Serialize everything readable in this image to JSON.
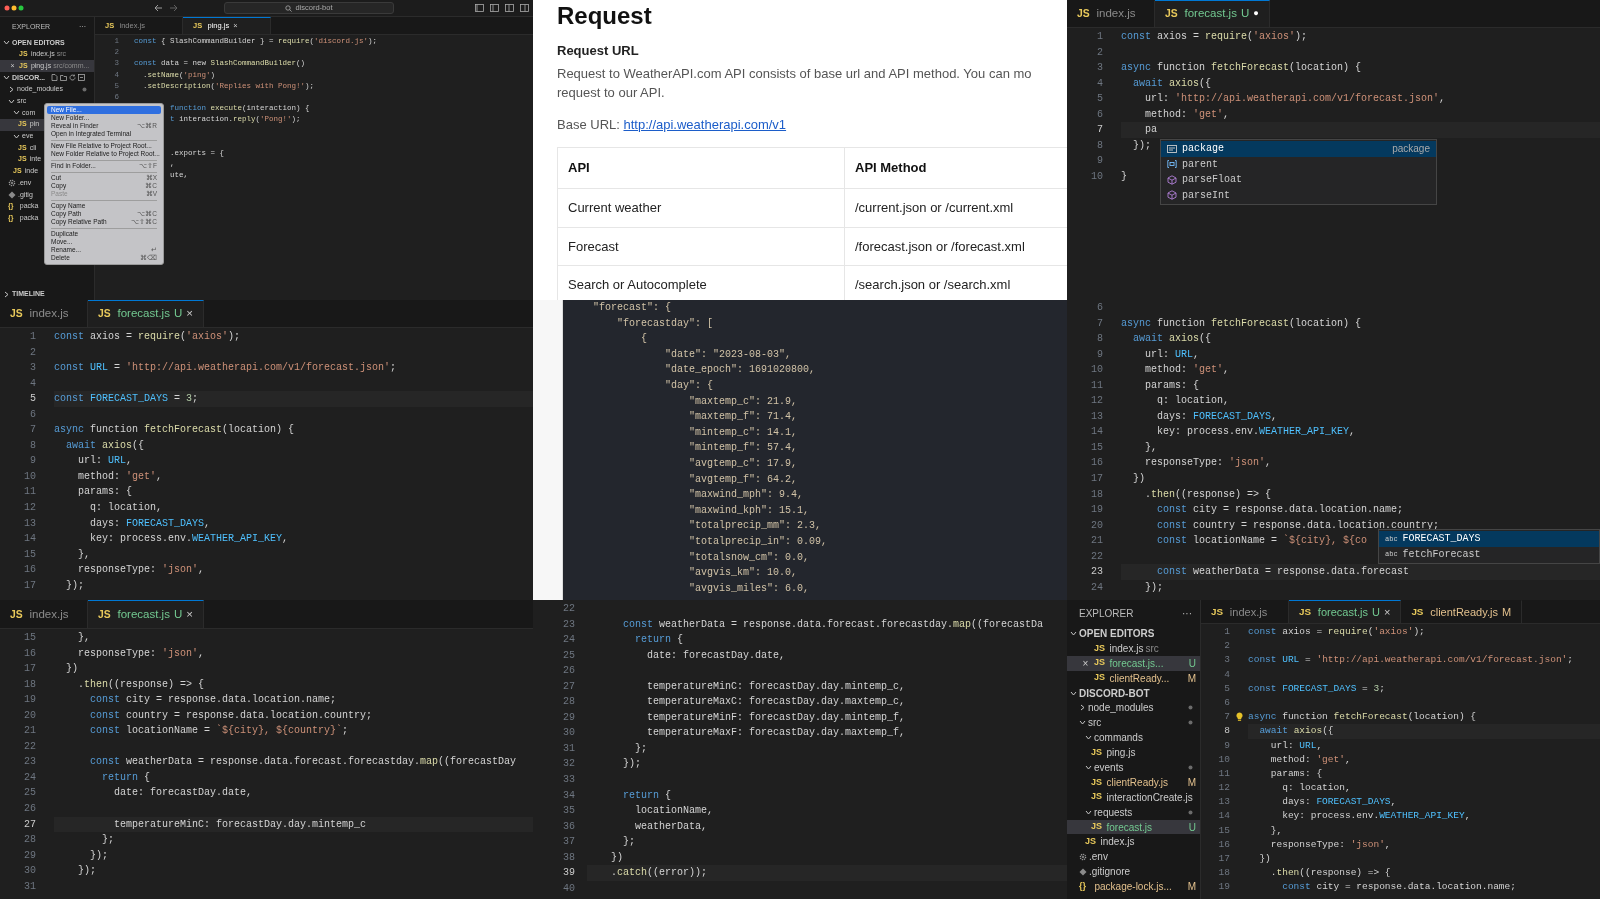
{
  "panels": [
    {
      "kind": "editor",
      "title_bar": {
        "search": "discord-bot"
      },
      "explorer": {
        "title": "EXPLORER",
        "more": "···",
        "sections": [
          {
            "kind": "open_editors",
            "label": "OPEN EDITORS",
            "expanded": true,
            "items": [
              {
                "icon": "JS",
                "label": "index.js",
                "hint": "src",
                "selected": false
              },
              {
                "close": "×",
                "icon": "JS",
                "label": "ping.js",
                "hint": "src/comm...",
                "selected": true
              }
            ]
          },
          {
            "kind": "folder",
            "label": "DISCOR...",
            "expanded": true,
            "toolbar": true,
            "items": [
              {
                "label": "node_modules",
                "expanded": false,
                "changes": true,
                "selected": false
              },
              {
                "label": "src",
                "expanded": true,
                "selected": false,
                "children": [
                  {
                    "label": "com",
                    "expanded": true,
                    "selected": false,
                    "children": [
                      {
                        "icon": "JS",
                        "label": "pin",
                        "selected": true
                      }
                    ]
                  },
                  {
                    "label": "eve",
                    "expanded": true,
                    "selected": false,
                    "children": [
                      {
                        "icon": "JS",
                        "label": "cli",
                        "selected": false
                      },
                      {
                        "icon": "JS",
                        "label": "inte",
                        "selected": false
                      }
                    ]
                  },
                  {
                    "icon": "JS",
                    "label": "inde",
                    "selected": false
                  }
                ]
              },
              {
                "kind": "env",
                "label": ".env",
                "selected": false
              },
              {
                "kind": "git",
                "label": ".gitig",
                "selected": false
              },
              {
                "icon": "{}",
                "label": "packa",
                "selected": false
              },
              {
                "icon": "{}",
                "label": "packa",
                "selected": false
              }
            ]
          },
          {
            "kind": "panel",
            "label": "TIMELINE",
            "expanded": false
          }
        ]
      },
      "tabs": [
        {
          "icon": "JS",
          "label": "index.js",
          "selected": false
        },
        {
          "icon": "JS",
          "label": "ping.js",
          "close": "×",
          "selected": true
        }
      ],
      "lines": [
        {
          "n": "1",
          "code": "const { SlashCommandBuilder } = require('discord.js');"
        },
        {
          "n": "2"
        },
        {
          "n": "3",
          "code": "const data = new SlashCommandBuilder()"
        },
        {
          "n": "4",
          "code": "  .setName('ping')"
        },
        {
          "n": "5",
          "code": "  .setDescription('Replies with Pong!');"
        },
        {
          "n": "6"
        },
        {
          "code": "function execute(interaction) {"
        },
        {
          "code": "t interaction.reply('Pong!');"
        },
        {
          "code": ".exports = {"
        },
        {
          "code": ","
        },
        {
          "code": "ute,"
        }
      ],
      "context_menu": {
        "groups": [
          [
            {
              "label": "New File...",
              "selected": true,
              "disabled": false
            },
            {
              "label": "New Folder...",
              "selected": false,
              "disabled": false
            },
            {
              "label": "Reveal in Finder",
              "shortcut": "⌥⌘R",
              "selected": false,
              "disabled": false
            },
            {
              "label": "Open in Integrated Terminal",
              "selected": false,
              "disabled": false
            }
          ],
          [
            {
              "label": "New File Relative to Project Root...",
              "selected": false,
              "disabled": false
            },
            {
              "label": "New Folder Relative to Project Root...",
              "selected": false,
              "disabled": false
            }
          ],
          [
            {
              "label": "Find in Folder...",
              "shortcut": "⌥⇧F",
              "selected": false,
              "disabled": false
            }
          ],
          [
            {
              "label": "Cut",
              "shortcut": "⌘X",
              "selected": false,
              "disabled": false
            },
            {
              "label": "Copy",
              "shortcut": "⌘C",
              "selected": false,
              "disabled": false
            },
            {
              "label": "Paste",
              "shortcut": "⌘V",
              "selected": false,
              "disabled": true
            }
          ],
          [
            {
              "label": "Copy Name",
              "selected": false,
              "disabled": false
            },
            {
              "label": "Copy Path",
              "shortcut": "⌥⌘C",
              "selected": false,
              "disabled": false
            },
            {
              "label": "Copy Relative Path",
              "shortcut": "⌥⇧⌘C",
              "selected": false,
              "disabled": false
            }
          ],
          [
            {
              "label": "Duplicate",
              "selected": false,
              "disabled": false
            },
            {
              "label": "Move...",
              "selected": false,
              "disabled": false
            },
            {
              "label": "Rename...",
              "shortcut": "↵",
              "selected": false,
              "disabled": false
            },
            {
              "label": "Delete",
              "shortcut": "⌘⌫",
              "selected": false,
              "disabled": false
            }
          ]
        ]
      }
    },
    {
      "kind": "doc",
      "heading": "Request",
      "subheading": "Request URL",
      "paragraph_lines": [
        "Request to WeatherAPI.com API consists of base url and API method. You can mo",
        "request to our API."
      ],
      "base_url": {
        "label": "Base URL:",
        "link": "http://api.weatherapi.com/v1"
      },
      "table": {
        "columns": [
          "API",
          "API Method"
        ],
        "rows": [
          [
            "Current weather",
            "/current.json or /current.xml"
          ],
          [
            "Forecast",
            "/forecast.json or /forecast.xml"
          ],
          [
            "Search or Autocomplete",
            "/search.json or /search.xml"
          ]
        ]
      }
    },
    {
      "kind": "editor",
      "tabs": [
        {
          "icon": "JS",
          "label": "index.js",
          "selected": false
        },
        {
          "icon": "JS",
          "label": "forecast.js",
          "badge": "U",
          "color": "#73c991",
          "unsaved": "●",
          "selected": true
        }
      ],
      "lines": [
        {
          "n": "1",
          "code": "const axios = require('axios');",
          "current": false
        },
        {
          "n": "2",
          "current": false
        },
        {
          "n": "3",
          "code": "async function fetchForecast(location) {",
          "current": false
        },
        {
          "n": "4",
          "code": "  await axios({",
          "current": false
        },
        {
          "n": "5",
          "code": "    url: 'http://api.weatherapi.com/v1/forecast.json',",
          "current": false
        },
        {
          "n": "6",
          "code": "    method: 'get',",
          "current": false
        },
        {
          "n": "7",
          "code": "    pa",
          "current": true
        },
        {
          "n": "8",
          "code": "  });",
          "current": false
        },
        {
          "n": "9",
          "current": false
        },
        {
          "n": "10",
          "code": "}",
          "current": false
        }
      ],
      "completion": {
        "items": [
          {
            "kind": "module",
            "label": "package",
            "detail": "package",
            "selected": true
          },
          {
            "kind": "variable",
            "label": "parent",
            "selected": false
          },
          {
            "kind": "method",
            "label": "parseFloat",
            "selected": false
          },
          {
            "kind": "method",
            "label": "parseInt",
            "selected": false
          }
        ]
      }
    },
    {
      "kind": "editor",
      "tabs": [
        {
          "icon": "JS",
          "label": "index.js",
          "selected": false
        },
        {
          "icon": "JS",
          "label": "forecast.js",
          "badge": "U",
          "color": "#73c991",
          "close": "×",
          "selected": true
        }
      ],
      "lines": [
        {
          "n": "1",
          "code": "const axios = require('axios');",
          "current": false
        },
        {
          "n": "2",
          "current": false
        },
        {
          "n": "3",
          "code": "const URL = 'http://api.weatherapi.com/v1/forecast.json';",
          "current": false
        },
        {
          "n": "4",
          "current": false
        },
        {
          "n": "5",
          "code": "const FORECAST_DAYS = 3;",
          "current": true
        },
        {
          "n": "6",
          "current": false
        },
        {
          "n": "7",
          "code": "async function fetchForecast(location) {",
          "current": false
        },
        {
          "n": "8",
          "code": "  await axios({",
          "current": false
        },
        {
          "n": "9",
          "code": "    url: URL,",
          "current": false
        },
        {
          "n": "10",
          "code": "    method: 'get',",
          "current": false
        },
        {
          "n": "11",
          "code": "    params: {",
          "current": false
        },
        {
          "n": "12",
          "code": "      q: location,",
          "current": false
        },
        {
          "n": "13",
          "code": "      days: FORECAST_DAYS,",
          "current": false
        },
        {
          "n": "14",
          "code": "      key: process.env.WEATHER_API_KEY,",
          "current": false
        },
        {
          "n": "15",
          "code": "    },",
          "current": false
        },
        {
          "n": "16",
          "code": "    responseType: 'json',",
          "current": false
        },
        {
          "n": "17",
          "code": "  });",
          "current": false
        }
      ]
    },
    {
      "kind": "json",
      "lines": [
        "\"forecast\": {",
        "    \"forecastday\": [",
        "        {",
        "            \"date\": \"2023-08-03\",",
        "            \"date_epoch\": 1691020800,",
        "            \"day\": {",
        "                \"maxtemp_c\": 21.9,",
        "                \"maxtemp_f\": 71.4,",
        "                \"mintemp_c\": 14.1,",
        "                \"mintemp_f\": 57.4,",
        "                \"avgtemp_c\": 17.9,",
        "                \"avgtemp_f\": 64.2,",
        "                \"maxwind_mph\": 9.4,",
        "                \"maxwind_kph\": 15.1,",
        "                \"totalprecip_mm\": 2.3,",
        "                \"totalprecip_in\": 0.09,",
        "                \"totalsnow_cm\": 0.0,",
        "                \"avgvis_km\": 10.0,",
        "                \"avgvis_miles\": 6.0,"
      ]
    },
    {
      "kind": "editor",
      "lines": [
        {
          "n": "6",
          "current": false
        },
        {
          "n": "7",
          "code": "async function fetchForecast(location) {",
          "current": false
        },
        {
          "n": "8",
          "code": "  await axios({",
          "current": false
        },
        {
          "n": "9",
          "code": "    url: URL,",
          "current": false
        },
        {
          "n": "10",
          "code": "    method: 'get',",
          "current": false
        },
        {
          "n": "11",
          "code": "    params: {",
          "current": false
        },
        {
          "n": "12",
          "code": "      q: location,",
          "current": false
        },
        {
          "n": "13",
          "code": "      days: FORECAST_DAYS,",
          "current": false
        },
        {
          "n": "14",
          "code": "      key: process.env.WEATHER_API_KEY,",
          "current": false
        },
        {
          "n": "15",
          "code": "    },",
          "current": false
        },
        {
          "n": "16",
          "code": "    responseType: 'json',",
          "current": false
        },
        {
          "n": "17",
          "code": "  })",
          "current": false
        },
        {
          "n": "18",
          "code": "    .then((response) => {",
          "current": false
        },
        {
          "n": "19",
          "code": "      const city = response.data.location.name;",
          "current": false
        },
        {
          "n": "20",
          "code": "      const country = response.data.location.country;",
          "current": false
        },
        {
          "n": "21",
          "code": "      const locationName = `${city}, ${co",
          "current": false
        },
        {
          "n": "22",
          "current": false
        },
        {
          "n": "23",
          "code": "      const weatherData = response.data.forecast",
          "current": true
        },
        {
          "n": "24",
          "code": "    });",
          "current": false
        }
      ],
      "completion": {
        "items": [
          {
            "icon": "abc",
            "label": "FORECAST_DAYS",
            "selected": true
          },
          {
            "icon": "abc",
            "label": "fetchForecast",
            "selected": false
          }
        ]
      }
    },
    {
      "kind": "editor",
      "tabs": [
        {
          "icon": "JS",
          "label": "index.js",
          "selected": false
        },
        {
          "icon": "JS",
          "label": "forecast.js",
          "badge": "U",
          "color": "#73c991",
          "close": "×",
          "selected": true
        }
      ],
      "lines": [
        {
          "n": "15",
          "code": "    },",
          "current": false
        },
        {
          "n": "16",
          "code": "    responseType: 'json',",
          "current": false
        },
        {
          "n": "17",
          "code": "  })",
          "current": false
        },
        {
          "n": "18",
          "code": "    .then((response) => {",
          "current": false
        },
        {
          "n": "19",
          "code": "      const city = response.data.location.name;",
          "current": false
        },
        {
          "n": "20",
          "code": "      const country = response.data.location.country;",
          "current": false
        },
        {
          "n": "21",
          "code": "      const locationName = `${city}, ${country}`;",
          "current": false
        },
        {
          "n": "22",
          "current": false
        },
        {
          "n": "23",
          "code": "      const weatherData = response.data.forecast.forecastday.map((forecastDay",
          "current": false
        },
        {
          "n": "24",
          "code": "        return {",
          "current": false
        },
        {
          "n": "25",
          "code": "          date: forecastDay.date,",
          "current": false
        },
        {
          "n": "26",
          "current": false
        },
        {
          "n": "27",
          "code": "          temperatureMinC: forecastDay.day.mintemp_c",
          "current": true
        },
        {
          "n": "28",
          "code": "        };",
          "current": false
        },
        {
          "n": "29",
          "code": "      });",
          "current": false
        },
        {
          "n": "30",
          "code": "    });",
          "current": false
        },
        {
          "n": "31",
          "current": false
        }
      ]
    },
    {
      "kind": "editor",
      "lines": [
        {
          "n": "22",
          "current": false
        },
        {
          "n": "23",
          "code": "      const weatherData = response.data.forecast.forecastday.map((forecastDa",
          "current": false
        },
        {
          "n": "24",
          "code": "        return {",
          "current": false
        },
        {
          "n": "25",
          "code": "          date: forecastDay.date,",
          "current": false
        },
        {
          "n": "26",
          "current": false
        },
        {
          "n": "27",
          "code": "          temperatureMinC: forecastDay.day.mintemp_c,",
          "current": false
        },
        {
          "n": "28",
          "code": "          temperatureMaxC: forecastDay.day.maxtemp_c,",
          "current": false
        },
        {
          "n": "29",
          "code": "          temperatureMinF: forecastDay.day.mintemp_f,",
          "current": false
        },
        {
          "n": "30",
          "code": "          temperatureMaxF: forecastDay.day.maxtemp_f,",
          "current": false
        },
        {
          "n": "31",
          "code": "        };",
          "current": false
        },
        {
          "n": "32",
          "code": "      });",
          "current": false
        },
        {
          "n": "33",
          "current": false
        },
        {
          "n": "34",
          "code": "      return {",
          "current": false
        },
        {
          "n": "35",
          "code": "        locationName,",
          "current": false
        },
        {
          "n": "36",
          "code": "        weatherData,",
          "current": false
        },
        {
          "n": "37",
          "code": "      };",
          "current": false
        },
        {
          "n": "38",
          "code": "    })",
          "current": false
        },
        {
          "n": "39",
          "code": "    .catch((error));",
          "current": true
        },
        {
          "n": "40",
          "current": false
        }
      ]
    },
    {
      "kind": "editor",
      "explorer": {
        "title": "EXPLORER",
        "more": "···",
        "sections": [
          {
            "kind": "open_editors",
            "label": "OPEN EDITORS",
            "expanded": true,
            "items": [
              {
                "icon": "JS",
                "label": "index.js",
                "hint": "src",
                "selected": false
              },
              {
                "close": "×",
                "icon": "JS",
                "label": "forecast.js...",
                "badge": "U",
                "untracked": true,
                "selected": true
              },
              {
                "icon": "JS",
                "label": "clientReady...",
                "badge": "M",
                "modified": true,
                "selected": false
              }
            ]
          },
          {
            "kind": "folder",
            "label": "DISCORD-BOT",
            "expanded": true,
            "items": [
              {
                "label": "node_modules",
                "expanded": false,
                "changes": true,
                "selected": false
              },
              {
                "label": "src",
                "expanded": true,
                "changes": true,
                "selected": false,
                "children": [
                  {
                    "label": "commands",
                    "expanded": true,
                    "selected": false,
                    "children": [
                      {
                        "icon": "JS",
                        "label": "ping.js",
                        "selected": false
                      }
                    ]
                  },
                  {
                    "label": "events",
                    "expanded": true,
                    "changes": true,
                    "selected": false,
                    "children": [
                      {
                        "icon": "JS",
                        "label": "clientReady.js",
                        "badge": "M",
                        "modified": true,
                        "selected": false
                      },
                      {
                        "icon": "JS",
                        "label": "interactionCreate.js",
                        "selected": false
                      }
                    ]
                  },
                  {
                    "label": "requests",
                    "expanded": true,
                    "changes": true,
                    "selected": false,
                    "children": [
                      {
                        "icon": "JS",
                        "label": "forecast.js",
                        "badge": "U",
                        "untracked": true,
                        "selected": true
                      }
                    ]
                  },
                  {
                    "icon": "JS",
                    "label": "index.js",
                    "selected": false
                  }
                ]
              },
              {
                "kind": "env",
                "label": ".env",
                "selected": false
              },
              {
                "kind": "git",
                "label": ".gitignore",
                "selected": false
              },
              {
                "icon": "{}",
                "label": "package-lock.js...",
                "badge": "M",
                "modified": true,
                "selected": false
              }
            ]
          }
        ]
      },
      "tabs": [
        {
          "icon": "JS",
          "label": "index.js",
          "selected": false
        },
        {
          "icon": "JS",
          "label": "forecast.js",
          "badge": "U",
          "color": "#73c991",
          "close": "×",
          "selected": true
        },
        {
          "icon": "JS",
          "label": "clientReady.js",
          "badge": "M",
          "color": "#e2c08d",
          "selected": false
        }
      ],
      "lines": [
        {
          "n": "1",
          "code": "const axios = require('axios');",
          "current": false
        },
        {
          "n": "2",
          "current": false
        },
        {
          "n": "3",
          "code": "const URL = 'http://api.weatherapi.com/v1/forecast.json';",
          "current": false
        },
        {
          "n": "4",
          "current": false
        },
        {
          "n": "5",
          "code": "const FORECAST_DAYS = 3;",
          "current": false
        },
        {
          "n": "6",
          "current": false
        },
        {
          "n": "7",
          "code": "async function fetchForecast(location) {",
          "lightbulb": true,
          "current": false
        },
        {
          "n": "8",
          "code": "  await axios({",
          "current": true
        },
        {
          "n": "9",
          "code": "    url: URL,",
          "current": false
        },
        {
          "n": "10",
          "code": "    method: 'get',",
          "current": false
        },
        {
          "n": "11",
          "code": "    params: {",
          "current": false
        },
        {
          "n": "12",
          "code": "      q: location,",
          "current": false
        },
        {
          "n": "13",
          "code": "      days: FORECAST_DAYS,",
          "current": false
        },
        {
          "n": "14",
          "code": "      key: process.env.WEATHER_API_KEY,",
          "current": false
        },
        {
          "n": "15",
          "code": "    },",
          "current": false
        },
        {
          "n": "16",
          "code": "    responseType: 'json',",
          "current": false
        },
        {
          "n": "17",
          "code": "  })",
          "current": false
        },
        {
          "n": "18",
          "code": "    .then((response) => {",
          "current": false
        },
        {
          "n": "19",
          "code": "      const city = response.data.location.name;",
          "current": false
        }
      ]
    }
  ]
}
